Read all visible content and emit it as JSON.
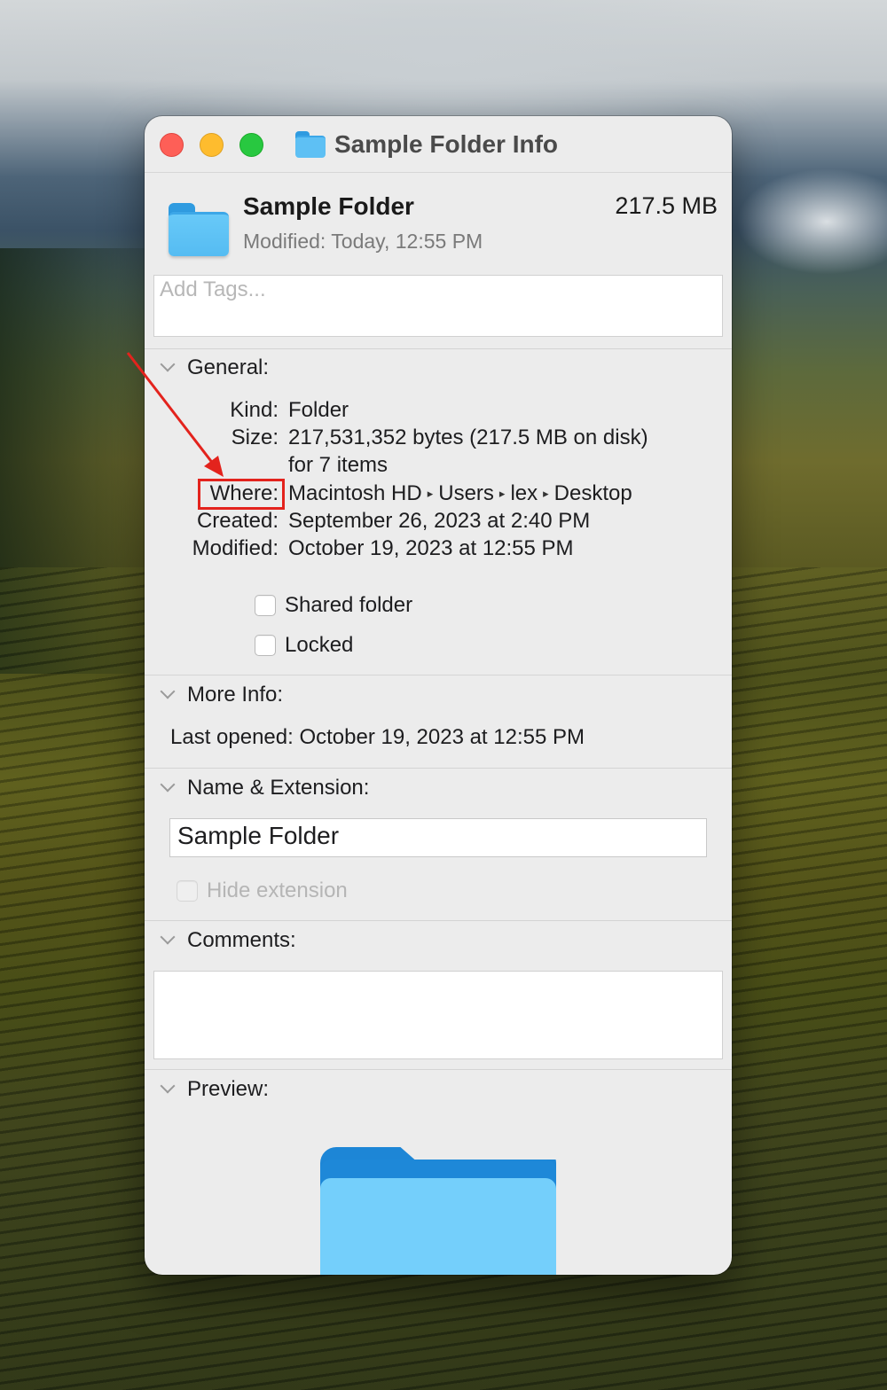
{
  "window": {
    "title": "Sample Folder Info"
  },
  "header": {
    "name": "Sample Folder",
    "size": "217.5 MB",
    "modified": "Modified:  Today, 12:55 PM"
  },
  "tags": {
    "placeholder": "Add Tags..."
  },
  "general": {
    "title": "General:",
    "kind_label": "Kind:",
    "kind_value": "Folder",
    "size_label": "Size:",
    "size_value": "217,531,352 bytes (217.5 MB on disk)",
    "size_value2": "for 7 items",
    "where_label": "Where:",
    "where_path": [
      "Macintosh HD",
      "Users",
      "lex",
      "Desktop"
    ],
    "path_separator": "▸",
    "created_label": "Created:",
    "created_value": "September 26, 2023 at 2:40 PM",
    "modified_label": "Modified:",
    "modified_value": "October 19, 2023 at 12:55 PM",
    "shared_label": "Shared folder",
    "locked_label": "Locked"
  },
  "more_info": {
    "title": "More Info:",
    "last_opened": "Last opened:  October 19, 2023 at 12:55 PM"
  },
  "name_ext": {
    "title": "Name & Extension:",
    "name_value": "Sample Folder",
    "hide_extension_label": "Hide extension"
  },
  "comments": {
    "title": "Comments:"
  },
  "preview": {
    "title": "Preview:"
  },
  "colors": {
    "annotation": "#e3231d",
    "folder_blue": "#62c4f6"
  }
}
